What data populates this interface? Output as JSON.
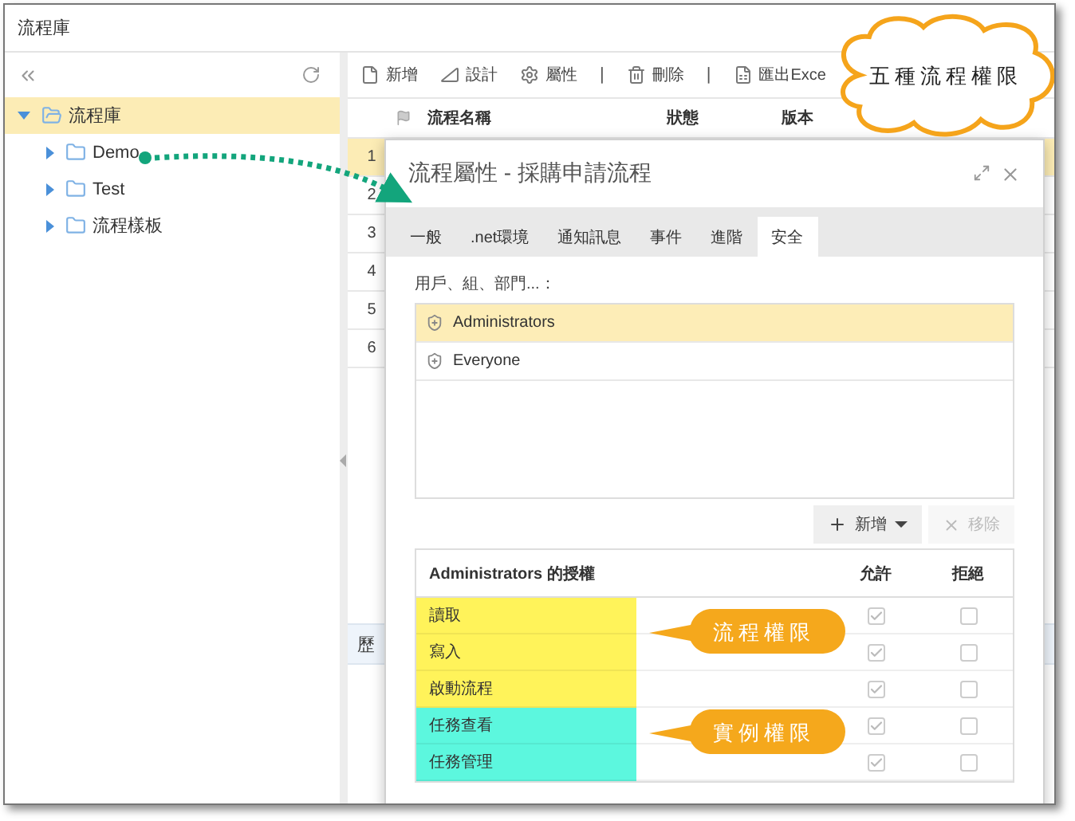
{
  "window": {
    "title": "流程庫"
  },
  "sidebar": {
    "tree": [
      {
        "label": "流程庫",
        "expanded": true,
        "selected": true,
        "children": [
          {
            "label": "Demo",
            "expanded": false,
            "selected": false
          },
          {
            "label": "Test",
            "expanded": false,
            "selected": false
          },
          {
            "label": "流程樣板",
            "expanded": false,
            "selected": false
          }
        ]
      }
    ]
  },
  "toolbar": [
    {
      "kind": "button",
      "label": "新增"
    },
    {
      "kind": "button",
      "label": "設計"
    },
    {
      "kind": "button",
      "label": "屬性"
    },
    {
      "kind": "separator",
      "label": "|"
    },
    {
      "kind": "button",
      "label": "刪除"
    },
    {
      "kind": "separator",
      "label": "|"
    },
    {
      "kind": "button",
      "label": "匯出Exce"
    }
  ],
  "table": {
    "columns": [
      "流程名稱",
      "狀態",
      "版本"
    ],
    "rows": [
      {
        "number": "1",
        "selected": true
      },
      {
        "number": "2",
        "selected": false
      },
      {
        "number": "3",
        "selected": false
      },
      {
        "number": "4",
        "selected": false
      },
      {
        "number": "5",
        "selected": false
      },
      {
        "number": "6",
        "selected": false
      }
    ]
  },
  "history_tab": "歷",
  "dialog": {
    "title": "流程屬性 - 採購申請流程",
    "tabs": [
      {
        "label": "一般",
        "selected": false
      },
      {
        "label": ".net環境",
        "selected": false
      },
      {
        "label": "通知訊息",
        "selected": false
      },
      {
        "label": "事件",
        "selected": false
      },
      {
        "label": "進階",
        "selected": false
      },
      {
        "label": "安全",
        "selected": true
      }
    ],
    "principals_label": "用戶、組、部門...：",
    "principals": [
      {
        "name": "Administrators",
        "selected": true
      },
      {
        "name": "Everyone",
        "selected": false
      }
    ],
    "buttons": [
      {
        "kind": "add",
        "label": "新增",
        "disabled": false
      },
      {
        "kind": "remove",
        "label": "移除",
        "disabled": true
      }
    ],
    "permissions": {
      "title": "Administrators 的授權",
      "columns": [
        "允許",
        "拒絕"
      ],
      "rows": [
        {
          "name": "讀取",
          "color": "#fff35a",
          "allow": true,
          "deny": false
        },
        {
          "name": "寫入",
          "color": "#fff35a",
          "allow": true,
          "deny": false
        },
        {
          "name": "啟動流程",
          "color": "#fff35a",
          "allow": true,
          "deny": false
        },
        {
          "name": "任務查看",
          "color": "#5cf7de",
          "allow": true,
          "deny": false
        },
        {
          "name": "任務管理",
          "color": "#5cf7de",
          "allow": true,
          "deny": false
        }
      ]
    }
  },
  "annotations": {
    "cloud": "五種流程權限",
    "callouts": [
      "流程權限",
      "實例權限"
    ]
  }
}
